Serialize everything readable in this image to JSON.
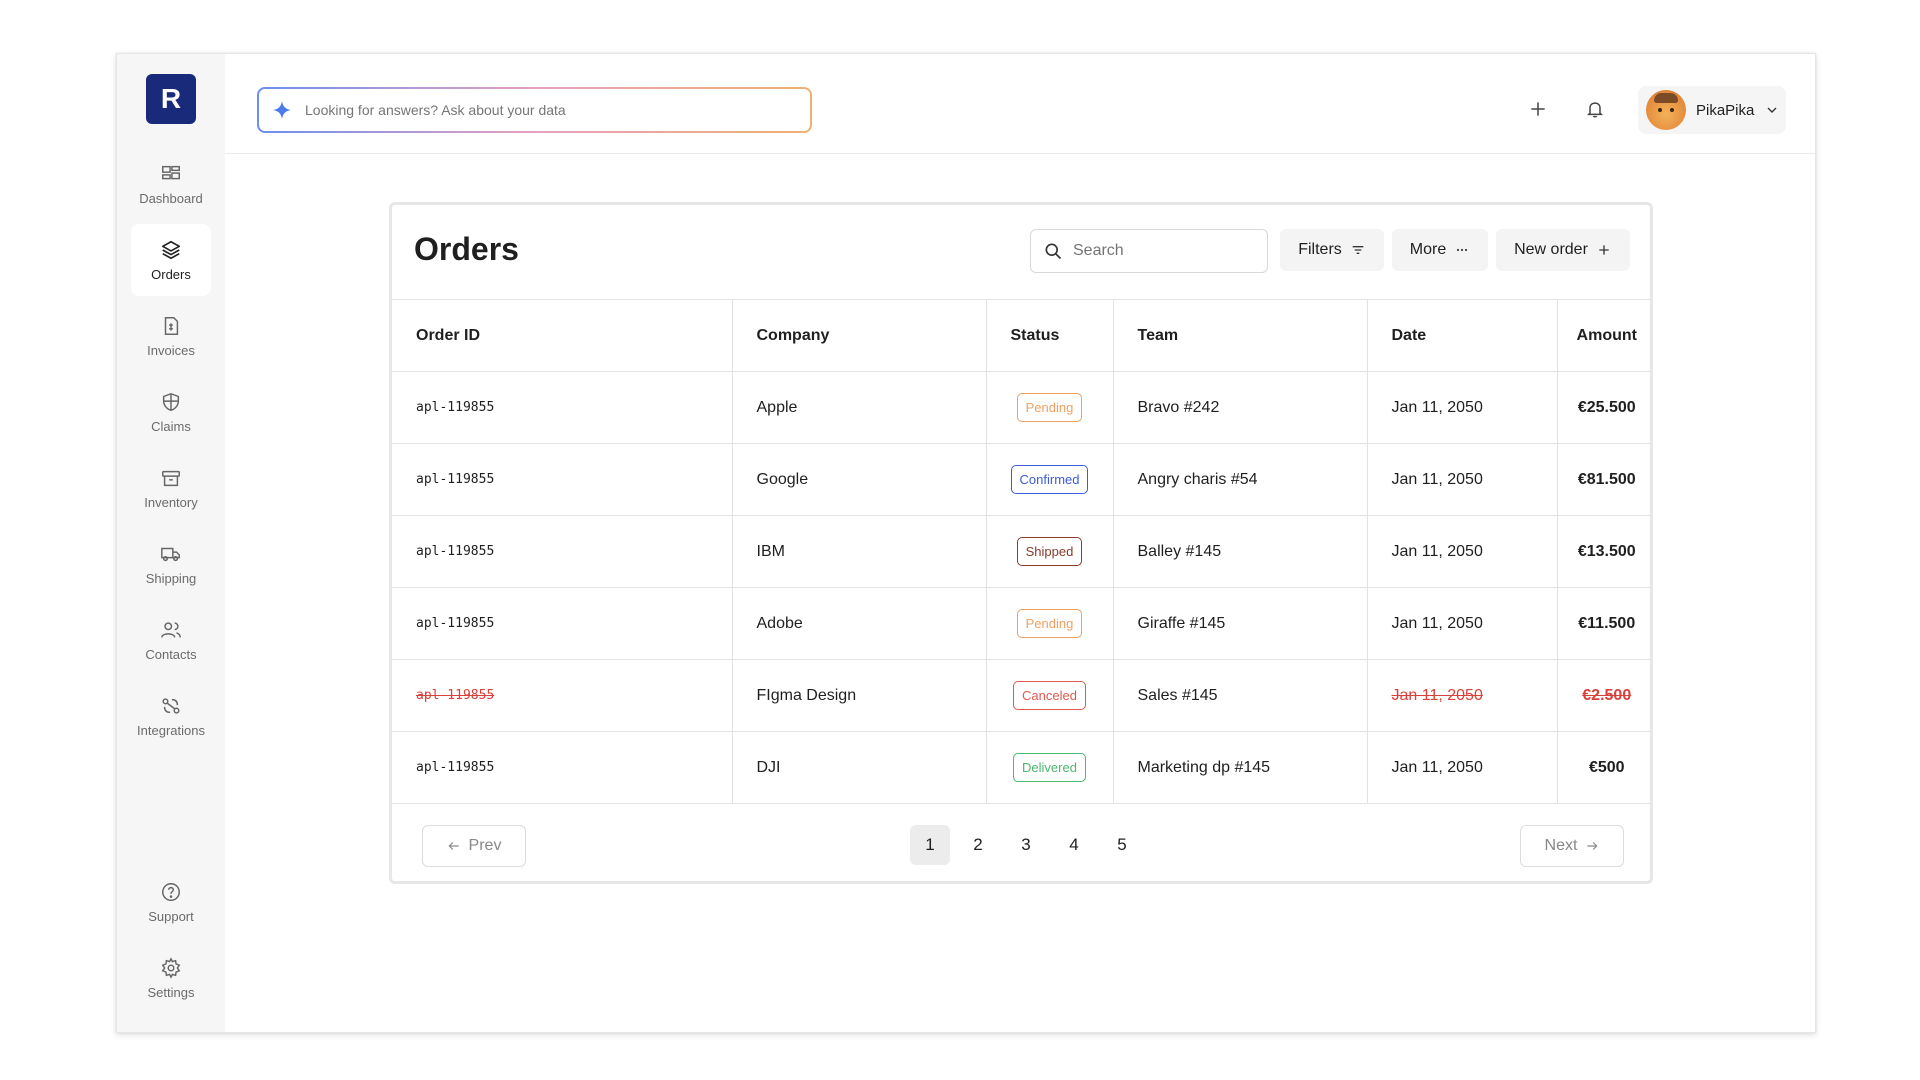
{
  "sidebar": {
    "logo": "R",
    "items": [
      {
        "label": "Dashboard",
        "icon": "dashboard-icon"
      },
      {
        "label": "Orders",
        "icon": "layers-icon",
        "active": true
      },
      {
        "label": "Invoices",
        "icon": "invoice-icon"
      },
      {
        "label": "Claims",
        "icon": "shield-icon"
      },
      {
        "label": "Inventory",
        "icon": "archive-icon"
      },
      {
        "label": "Shipping",
        "icon": "truck-icon"
      },
      {
        "label": "Contacts",
        "icon": "users-icon"
      },
      {
        "label": "Integrations",
        "icon": "integrations-icon"
      }
    ],
    "bottom": [
      {
        "label": "Support",
        "icon": "help-circle-icon"
      },
      {
        "label": "Settings",
        "icon": "gear-icon"
      }
    ]
  },
  "topbar": {
    "ask_placeholder": "Looking for answers? Ask about your data",
    "user_name": "PikaPika"
  },
  "orders": {
    "title": "Orders",
    "search_placeholder": "Search",
    "filters_label": "Filters",
    "more_label": "More",
    "new_order_label": "New order",
    "columns": [
      "Order ID",
      "Company",
      "Status",
      "Team",
      "Date",
      "Amount"
    ],
    "rows": [
      {
        "id": "apl-119855",
        "company": "Apple",
        "status": "Pending",
        "team": "Bravo #242",
        "date": "Jan 11, 2050",
        "amount": "€25.500"
      },
      {
        "id": "apl-119855",
        "company": "Google",
        "status": "Confirmed",
        "team": "Angry charis #54",
        "date": "Jan 11, 2050",
        "amount": "€81.500"
      },
      {
        "id": "apl-119855",
        "company": "IBM",
        "status": "Shipped",
        "team": "Balley #145",
        "date": "Jan 11, 2050",
        "amount": "€13.500"
      },
      {
        "id": "apl-119855",
        "company": "Adobe",
        "status": "Pending",
        "team": "Giraffe #145",
        "date": "Jan 11, 2050",
        "amount": "€11.500"
      },
      {
        "id": "apl-119855",
        "company": "FIgma Design",
        "status": "Canceled",
        "team": "Sales #145",
        "date": "Jan 11, 2050",
        "amount": "€2.500",
        "canceled": true
      },
      {
        "id": "apl-119855",
        "company": "DJI",
        "status": "Delivered",
        "team": "Marketing dp #145",
        "date": "Jan 11, 2050",
        "amount": "€500"
      }
    ],
    "status_colors": {
      "Pending": "#f0a060",
      "Confirmed": "#3b5bdb",
      "Shipped": "#8a3b2a",
      "Canceled": "#e05a50",
      "Delivered": "#4cb870"
    },
    "pagination": {
      "prev_label": "Prev",
      "next_label": "Next",
      "pages": [
        "1",
        "2",
        "3",
        "4",
        "5"
      ],
      "current": "1"
    }
  }
}
